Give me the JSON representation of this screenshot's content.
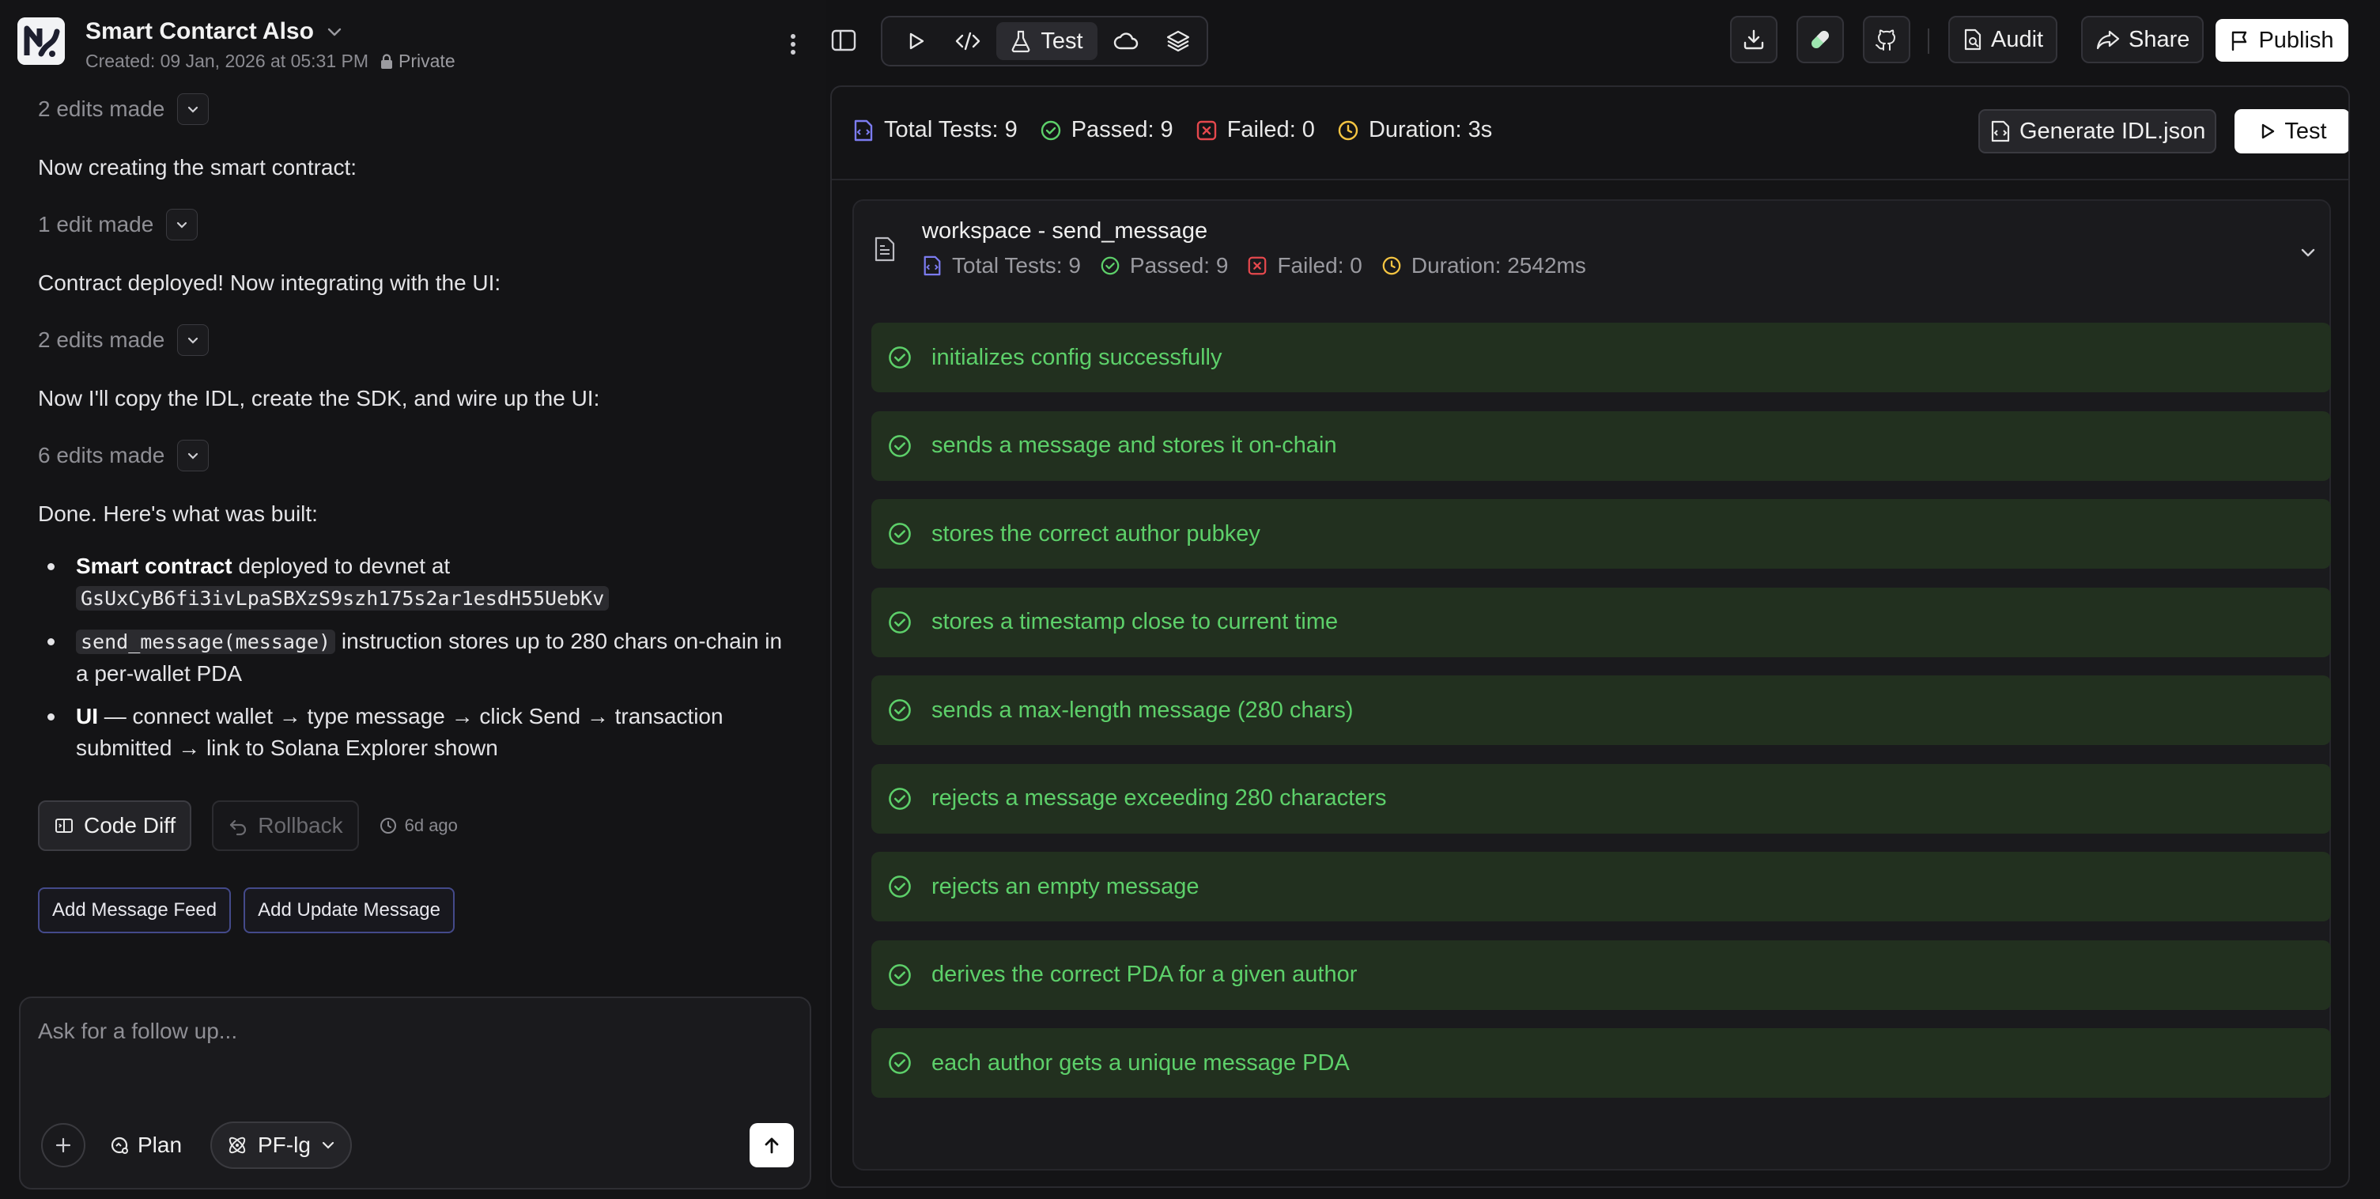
{
  "project": {
    "title": "Smart Contarct Also",
    "created": "Created: 09 Jan, 2026 at 05:31 PM",
    "visibility": "Private"
  },
  "chat": {
    "edit1": "2 edits made",
    "msg1": "Now creating the smart contract:",
    "edit2": "1 edit made",
    "msg2": "Contract deployed! Now integrating with the UI:",
    "edit3": "2 edits made",
    "msg3": "Now I'll copy the IDL, create the SDK, and wire up the UI:",
    "edit4": "6 edits made",
    "msg4": "Done. Here's what was built:",
    "bullets": [
      {
        "bold": "Smart contract",
        "text1": " deployed to devnet at ",
        "code": "GsUxCyB6fi3ivLpaSBXzS9szh175s2ar1esdH55UebKv"
      },
      {
        "code": "send_message(message)",
        "text1": " instruction stores up to 280 chars on-chain in a per-wallet PDA"
      },
      {
        "bold": "UI",
        "text1": " — connect wallet → type message → click Send → transaction submitted → link to Solana Explorer shown"
      }
    ],
    "code_diff_label": "Code Diff",
    "rollback_label": "Rollback",
    "time_ago": "6d ago",
    "suggestions": [
      "Add Message Feed",
      "Add Update Message"
    ]
  },
  "composer": {
    "placeholder": "Ask for a follow up...",
    "plan_label": "Plan",
    "model_label": "PF-lg"
  },
  "toolbar": {
    "active_tab_label": "Test",
    "audit_label": "Audit",
    "share_label": "Share",
    "publish_label": "Publish"
  },
  "summary": {
    "total": "Total Tests: 9",
    "passed": "Passed: 9",
    "failed": "Failed: 0",
    "duration": "Duration: 3s",
    "generate_label": "Generate IDL.json",
    "test_label": "Test"
  },
  "suite": {
    "title": "workspace - send_message",
    "total": "Total Tests: 9",
    "passed": "Passed: 9",
    "failed": "Failed: 0",
    "duration": "Duration: 2542ms",
    "tests": [
      "initializes config successfully",
      "sends a message and stores it on-chain",
      "stores the correct author pubkey",
      "stores a timestamp close to current time",
      "sends a max-length message (280 chars)",
      "rejects a message exceeding 280 characters",
      "rejects an empty message",
      "derives the correct PDA for a given author",
      "each author gets a unique message PDA"
    ]
  },
  "colors": {
    "pass_green": "#5dd06a",
    "pass_row_bg": "#22301f",
    "fail_red": "#e5484d",
    "duration_yellow": "#f5c542",
    "total_purple": "#7c7cf0",
    "chip_border": "#444a8a"
  },
  "icons": {
    "logo": "app-logo",
    "private": "lock-icon",
    "run": "play-icon",
    "code": "code-icon",
    "test": "flask-icon",
    "deploy": "cloud-icon",
    "layers": "layers-icon",
    "download": "download-icon",
    "pill": "pill-icon",
    "github": "github-icon",
    "audit": "document-icon",
    "share": "share-icon",
    "publish": "flag-icon"
  }
}
